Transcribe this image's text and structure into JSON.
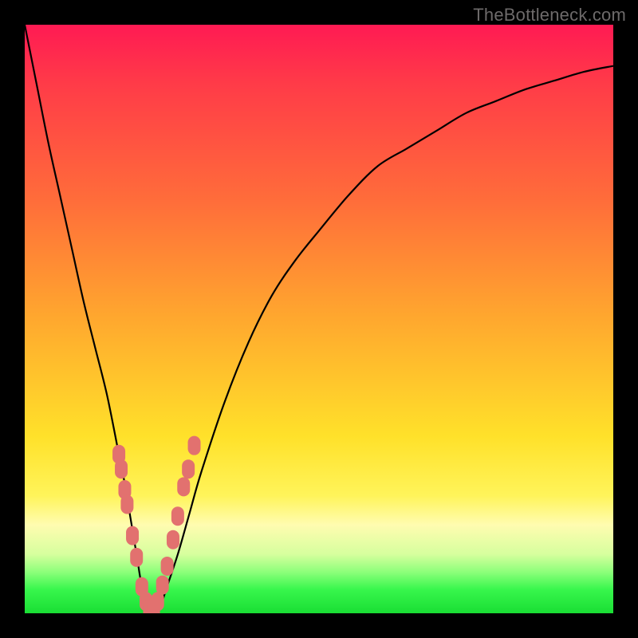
{
  "watermark": "TheBottleneck.com",
  "colors": {
    "frame": "#000000",
    "curve": "#000000",
    "marker_fill": "#e2716f",
    "gradient_stops": [
      "#ff1a53",
      "#ff6d3a",
      "#ffe12a",
      "#fffcb0",
      "#1ade34"
    ]
  },
  "chart_data": {
    "type": "line",
    "title": "",
    "xlabel": "",
    "ylabel": "",
    "xlim": [
      0,
      100
    ],
    "ylim": [
      0,
      100
    ],
    "grid": false,
    "legend": false,
    "x": [
      0,
      2,
      4,
      6,
      8,
      10,
      12,
      14,
      16,
      17,
      18,
      19,
      20,
      21,
      22,
      23,
      24,
      26,
      28,
      30,
      34,
      38,
      42,
      46,
      50,
      55,
      60,
      65,
      70,
      75,
      80,
      85,
      90,
      95,
      100
    ],
    "y": [
      100,
      90,
      80,
      71,
      62,
      53,
      45,
      37,
      27,
      22,
      16,
      10,
      4,
      1,
      0,
      1,
      4,
      10,
      17,
      24,
      36,
      46,
      54,
      60,
      65,
      71,
      76,
      79,
      82,
      85,
      87,
      89,
      90.5,
      92,
      93
    ],
    "markers": {
      "x": [
        16.0,
        16.4,
        17.0,
        17.4,
        18.3,
        19.0,
        19.9,
        20.6,
        21.2,
        21.9,
        22.6,
        23.4,
        24.2,
        25.2,
        26.0,
        27.0,
        27.8,
        28.8
      ],
      "y": [
        27.0,
        24.5,
        21.0,
        18.5,
        13.2,
        9.5,
        4.5,
        2.0,
        0.7,
        0.5,
        2.0,
        4.8,
        8.0,
        12.5,
        16.5,
        21.5,
        24.5,
        28.5
      ]
    }
  }
}
